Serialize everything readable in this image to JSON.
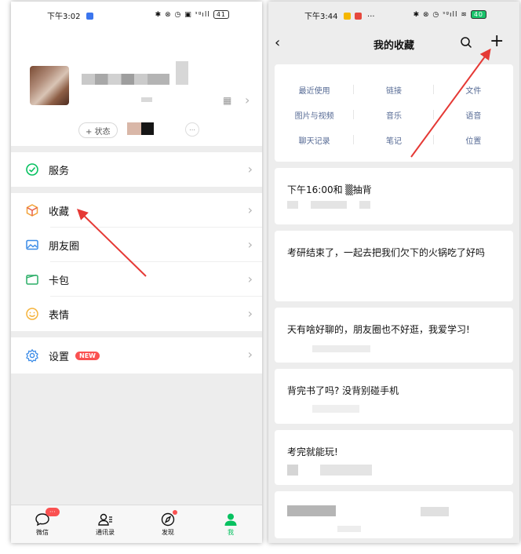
{
  "left": {
    "statusbar": {
      "time": "下午3:02",
      "icons": "✱ ⊗ ◷ ▣ ᵌᵍıll",
      "battery": "41"
    },
    "profile": {
      "status_label": "+ 状态"
    },
    "menu": [
      {
        "name": "service",
        "label": "服务"
      },
      {
        "name": "favorites",
        "label": "收藏"
      },
      {
        "name": "moments",
        "label": "朋友圈"
      },
      {
        "name": "cards",
        "label": "卡包"
      },
      {
        "name": "stickers",
        "label": "表情"
      }
    ],
    "settings": {
      "label": "设置",
      "badge": "NEW"
    },
    "tabbar": {
      "chats": "微信",
      "chats_badge": "···",
      "contacts": "通讯录",
      "discover": "发现",
      "me": "我"
    }
  },
  "right": {
    "statusbar": {
      "time": "下午3:44",
      "extra": "···",
      "icons": "✱ ⊗ ◷ ᵌᵍıll ≋",
      "battery": "40"
    },
    "title": "我的收藏",
    "categories": [
      "最近使用",
      "链接",
      "文件",
      "图片与视频",
      "音乐",
      "语音",
      "聊天记录",
      "笔记",
      "位置"
    ],
    "items": [
      "下午16:00和 ▒抽背",
      "考研结束了，一起去把我们欠下的火锅吃了好吗",
      "天有啥好聊的，朋友圈也不好逛，我爱学习!",
      "背完书了吗? 没背别碰手机",
      "考完就能玩!"
    ]
  },
  "colors": {
    "brand_green": "#07c160",
    "badge_red": "#fa5151",
    "link_blue": "#576b95",
    "annotation_arrow": "#e53935"
  }
}
